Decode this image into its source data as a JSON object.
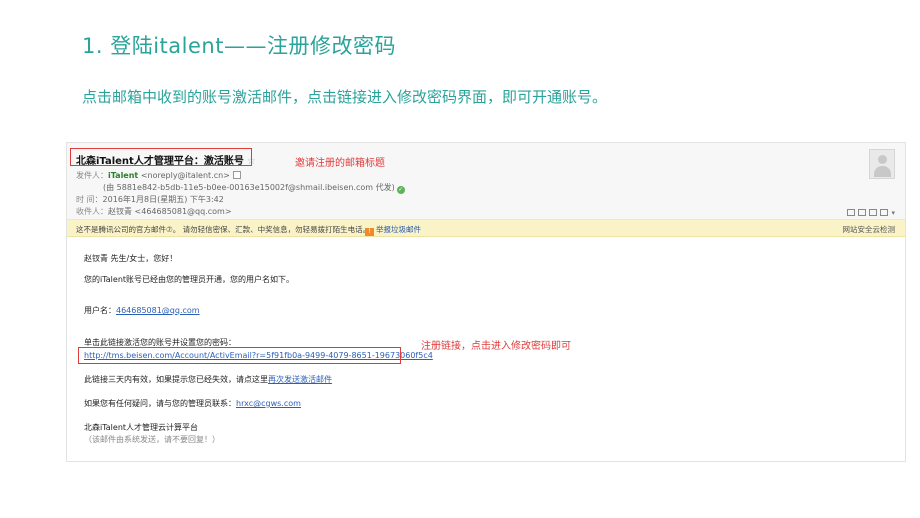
{
  "slide": {
    "title": "1. 登陆italent——注册修改密码",
    "description": "点击邮箱中收到的账号激活邮件，点击链接进入修改密码界面，即可开通账号。"
  },
  "email": {
    "subject": "北森iTalent人才管理平台：激活账号",
    "star": "☆",
    "from_label": "发件人：",
    "from_name": "iTalent",
    "from_addr": "<noreply@italent.cn>",
    "via_line": "(由 5881e842-b5db-11e5-b0ee-00163e15002f@shmail.ibeisen.com 代发)",
    "time_label": "时  间：",
    "time_value": "2016年1月8日(星期五) 下午3:42",
    "to_label": "收件人：",
    "to_value": "赵钗青 <464685081@qq.com>"
  },
  "warning": {
    "text": "这不是腾讯公司的官方邮件⑦。 请勿轻信密保、汇款、中奖信息，勿轻易拨打陌生电话。",
    "report": "举报垃圾邮件",
    "right": "网站安全云检测"
  },
  "annotations": {
    "subject_note": "邀请注册的邮箱标题",
    "link_note": "注册链接，点击进入修改密码即可"
  },
  "body": {
    "greeting": "赵钗青 先生/女士，您好！",
    "line1": "您的iTalent账号已经由您的管理员开通，您的用户名如下。",
    "username_label": "用户名：",
    "username": "464685081@qq.com",
    "click_line": "单击此链接激活您的账号并设置您的密码：",
    "activation_link": "http://tms.beisen.com/Account/ActivEmail?r=5f91fb0a-9499-4079-8651-19673060f5c4",
    "expire_line": "此链接三天内有效，如果提示您已经失效，请点这里",
    "resend_link": "再次发送激活邮件",
    "contact_line": "如果您有任何疑问，请与您的管理员联系：",
    "contact_email": "hrxc@cgws.com",
    "signature": "北森iTalent人才管理云计算平台",
    "auto_note": "（该邮件由系统发送，请不要回复！）"
  },
  "colors": {
    "accent": "#2aa39a",
    "annotation_red": "#e03a3a",
    "link_blue": "#2c5fb8",
    "warning_bg": "#fbf3c8"
  },
  "icons": [
    "star-icon",
    "contact-card-icon",
    "verified-check-icon",
    "avatar-icon",
    "warning-icon",
    "mail-tool-icons"
  ]
}
